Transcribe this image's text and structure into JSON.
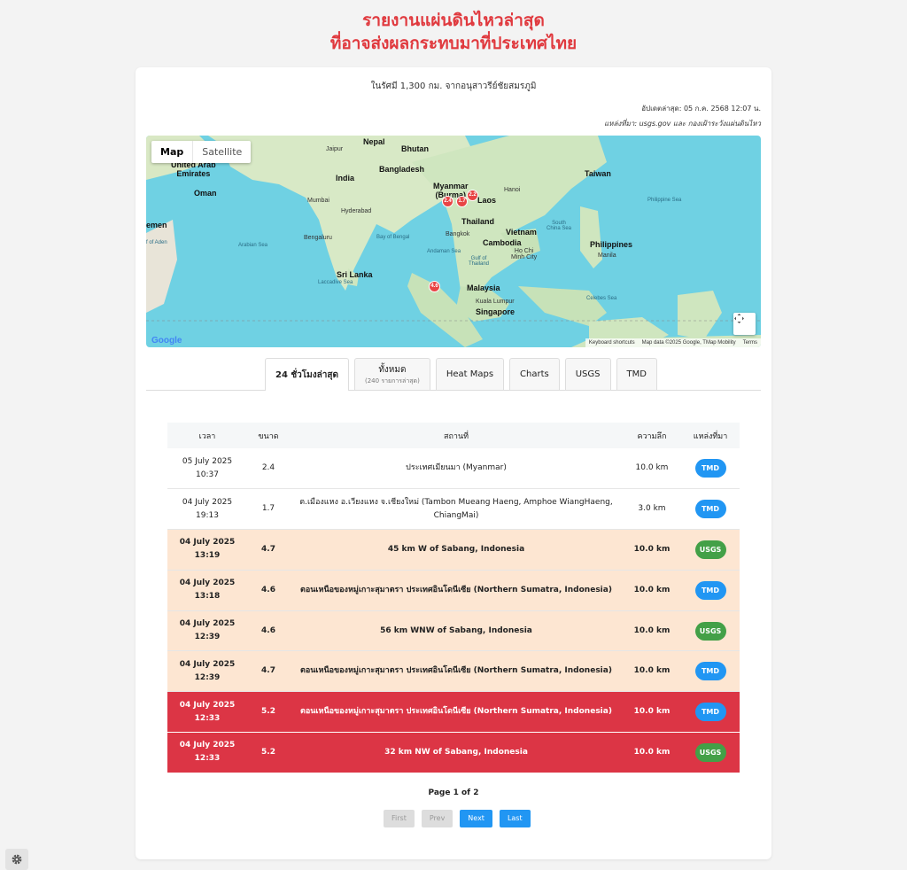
{
  "header": {
    "title_line1": "รายงานแผ่นดินไหวล่าสุด",
    "title_line2": "ที่อาจส่งผลกระทบมาที่ประเทศไทย"
  },
  "card": {
    "subtitle": "ในรัศมี 1,300 กม. จากอนุสาวรีย์ชัยสมรภูมิ",
    "updated": "อัปเดตล่าสุด: 05 ก.ค. 2568 12:07 น.",
    "source": "แหล่งที่มา: usgs.gov และ กองเฝ้าระวังแผ่นดินไหว"
  },
  "map": {
    "type_buttons": [
      "Map",
      "Satellite"
    ],
    "footer": [
      "Keyboard shortcuts",
      "Map data ©2025 Google, TMap Mobility",
      "Terms"
    ],
    "logo": "Google",
    "labels": {
      "nepal": "Nepal",
      "bhutan": "Bhutan",
      "bangladesh": "Bangladesh",
      "india": "India",
      "myanmar": "Myanmar\n(Burma)",
      "laos": "Laos",
      "thailand": "Thailand",
      "cambodia": "Cambodia",
      "vietnam": "Vietnam",
      "philippines": "Philippines",
      "taiwan": "Taiwan",
      "sri_lanka": "Sri Lanka",
      "malaysia": "Malaysia",
      "singapore": "Singapore",
      "oman": "Oman",
      "uae": "United Arab\nEmirates",
      "yemen": "emen",
      "hyderabad": "Hyderabad",
      "mumbai": "Mumbai",
      "bengaluru": "Bengaluru",
      "bangkok": "Bangkok",
      "hanoi": "Hanoi",
      "kuala_lumpur": "Kuala Lumpur",
      "manila": "Manila",
      "jaipur": "Jaipur",
      "ho_chi_minh": "Ho Chi\nMinh City",
      "arabian_sea": "Arabian Sea",
      "bay_of_bengal": "Bay of Bengal",
      "andaman_sea": "Andaman Sea",
      "south_china_sea": "South\nChina Sea",
      "philippine_sea": "Philippine Sea",
      "celebes_sea": "Celebes Sea",
      "laccadive_sea": "Laccadive Sea",
      "gulf_of_thailand": "Gulf of\nThailand",
      "gulf_of_aden": "f of Aden"
    },
    "markers": [
      "2.4",
      "1.7",
      "2.2",
      "4.6"
    ]
  },
  "tabs": [
    {
      "label": "24 ชั่วโมงล่าสุด",
      "sub": ""
    },
    {
      "label": "ทั้งหมด",
      "sub": "(240 รายการล่าสุด)"
    },
    {
      "label": "Heat Maps",
      "sub": ""
    },
    {
      "label": "Charts",
      "sub": ""
    },
    {
      "label": "USGS",
      "sub": ""
    },
    {
      "label": "TMD",
      "sub": ""
    }
  ],
  "table": {
    "headers": [
      "เวลา",
      "ขนาด",
      "สถานที่",
      "ความลึก",
      "แหล่งที่มา"
    ],
    "rows": [
      {
        "date": "05 July 2025",
        "time": "10:37",
        "mag": "2.4",
        "place": "ประเทศเมียนมา (Myanmar)",
        "depth": "10.0 km",
        "source": "TMD",
        "level": "low"
      },
      {
        "date": "04 July 2025",
        "time": "19:13",
        "mag": "1.7",
        "place": "ต.เมืองแหง อ.เวียงแหง จ.เชียงใหม่ (Tambon Mueang Haeng, Amphoe WiangHaeng, ChiangMai)",
        "depth": "3.0 km",
        "source": "TMD",
        "level": "low"
      },
      {
        "date": "04 July 2025",
        "time": "13:19",
        "mag": "4.7",
        "place": "45 km W of Sabang, Indonesia",
        "depth": "10.0 km",
        "source": "USGS",
        "level": "mid"
      },
      {
        "date": "04 July 2025",
        "time": "13:18",
        "mag": "4.6",
        "place": "ตอนเหนือของหมู่เกาะสุมาตรา ประเทศอินโดนีเซีย (Northern Sumatra, Indonesia)",
        "depth": "10.0 km",
        "source": "TMD",
        "level": "mid"
      },
      {
        "date": "04 July 2025",
        "time": "12:39",
        "mag": "4.6",
        "place": "56 km WNW of Sabang, Indonesia",
        "depth": "10.0 km",
        "source": "USGS",
        "level": "mid"
      },
      {
        "date": "04 July 2025",
        "time": "12:39",
        "mag": "4.7",
        "place": "ตอนเหนือของหมู่เกาะสุมาตรา ประเทศอินโดนีเซีย (Northern Sumatra, Indonesia)",
        "depth": "10.0 km",
        "source": "TMD",
        "level": "mid"
      },
      {
        "date": "04 July 2025",
        "time": "12:33",
        "mag": "5.2",
        "place": "ตอนเหนือของหมู่เกาะสุมาตรา ประเทศอินโดนีเซีย (Northern Sumatra, Indonesia)",
        "depth": "10.0 km",
        "source": "TMD",
        "level": "high"
      },
      {
        "date": "04 July 2025",
        "time": "12:33",
        "mag": "5.2",
        "place": "32 km NW of Sabang, Indonesia",
        "depth": "10.0 km",
        "source": "USGS",
        "level": "high"
      }
    ]
  },
  "pagination": {
    "text": "Page 1 of 2",
    "buttons": [
      {
        "label": "First",
        "enabled": false
      },
      {
        "label": "Prev",
        "enabled": false
      },
      {
        "label": "Next",
        "enabled": true
      },
      {
        "label": "Last",
        "enabled": true
      }
    ]
  },
  "colors": {
    "title": "#e0393e",
    "tmd_badge": "#2196f3",
    "usgs_badge": "#43a047",
    "mid_row": "#fde6d2",
    "high_row": "#dc3545"
  },
  "icons": {
    "settings": "gear-icon",
    "fullscreen": "fullscreen-icon"
  }
}
